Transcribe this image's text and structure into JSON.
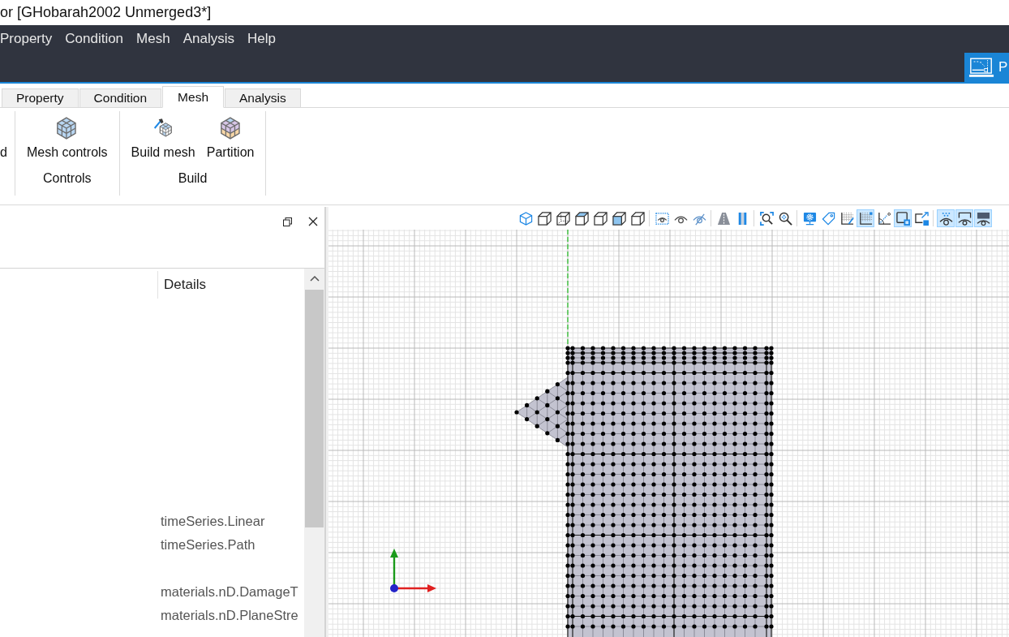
{
  "window": {
    "title": "or [GHobarah2002 Unmerged3*]"
  },
  "menu": {
    "items": [
      "Property",
      "Condition",
      "Mesh",
      "Analysis",
      "Help"
    ],
    "mode_button": {
      "label": "P"
    }
  },
  "ribbon": {
    "tabs": [
      {
        "label": "Property",
        "selected": false
      },
      {
        "label": "Condition",
        "selected": false
      },
      {
        "label": "Mesh",
        "selected": true
      },
      {
        "label": "Analysis",
        "selected": false
      }
    ],
    "groups": [
      {
        "buttons": [
          {
            "label": "d"
          }
        ]
      },
      {
        "label": "Controls",
        "buttons": [
          {
            "label": "Mesh controls",
            "kind": "cubes"
          }
        ]
      },
      {
        "label": "Build",
        "buttons": [
          {
            "label": "Build mesh",
            "kind": "hammer"
          },
          {
            "label": "Partition",
            "kind": "partition"
          }
        ]
      }
    ]
  },
  "tree_panel": {
    "details_heading": "Details",
    "groups": [
      {
        "rows": [
          "timeSeries.Linear",
          "timeSeries.Path"
        ]
      },
      {
        "rows": [
          "materials.nD.DamageT",
          "materials.nD.PlaneStre"
        ]
      }
    ]
  },
  "viewport": {
    "toolbar": {
      "groups": [
        {
          "buttons": [
            {
              "kind": "isometric",
              "selected": false
            },
            {
              "kind": "front",
              "selected": false
            },
            {
              "kind": "back",
              "selected": false
            },
            {
              "kind": "top",
              "selected": false
            },
            {
              "kind": "bottom",
              "selected": false
            },
            {
              "kind": "left",
              "selected": false
            },
            {
              "kind": "right",
              "selected": false
            }
          ]
        },
        {
          "buttons": [
            {
              "kind": "showarea",
              "selected": false
            },
            {
              "kind": "show",
              "selected": false
            },
            {
              "kind": "hide",
              "selected": false
            }
          ]
        },
        {
          "buttons": [
            {
              "kind": "perspective",
              "selected": false
            },
            {
              "kind": "parallel",
              "selected": false
            }
          ]
        },
        {
          "buttons": [
            {
              "kind": "zoomfit",
              "selected": false
            },
            {
              "kind": "zoom",
              "selected": false
            }
          ]
        },
        {
          "buttons": [
            {
              "kind": "display",
              "selected": false
            },
            {
              "kind": "label",
              "selected": false
            },
            {
              "kind": "gridedit",
              "selected": false
            },
            {
              "kind": "grid",
              "selected": true
            },
            {
              "kind": "angle",
              "selected": false
            },
            {
              "kind": "frame",
              "selected": true
            },
            {
              "kind": "pick",
              "selected": false
            }
          ]
        },
        {
          "buttons": [
            {
              "kind": "eyeall",
              "selected": true
            },
            {
              "kind": "eyeframe",
              "selected": true
            },
            {
              "kind": "eyescreen",
              "selected": true
            }
          ]
        }
      ]
    }
  }
}
